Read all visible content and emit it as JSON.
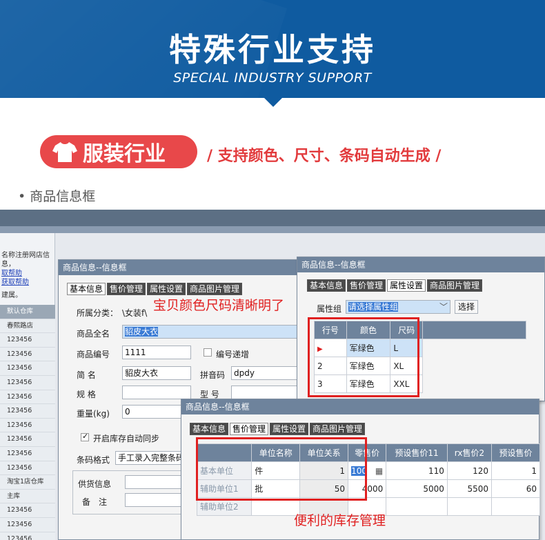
{
  "banner": {
    "title": "特殊行业支持",
    "subtitle": "SPECIAL INDUSTRY SUPPORT",
    "bg_color": "#0f5ba0"
  },
  "feature": {
    "pill_label": "服装行业",
    "icon": "tshirt-icon",
    "tagline": "/ 支持颜色、尺寸、条码自动生成 /",
    "accent": "#e8484a"
  },
  "section_label": "• 商品信息框",
  "left_panel": {
    "note": "名称注册网店信息，",
    "links": [
      "取帮助",
      "获取帮助"
    ],
    "note2": "建属。",
    "warehouses": [
      "默认仓库",
      "春熙路店",
      "123456",
      "123456",
      "123456",
      "123456",
      "123456",
      "123456",
      "123456",
      "123456",
      "123456",
      "123456",
      "淘宝1店仓库",
      "主库",
      "123456",
      "123456",
      "123456",
      "123456"
    ]
  },
  "win1": {
    "title": "商品信息--信息框",
    "tabs": [
      "基本信息",
      "售价管理",
      "属性设置",
      "商品图片管理"
    ],
    "category_label": "所属分类：",
    "category_value": "\\女装f\\",
    "fullname_label": "商品全名",
    "fullname_value": "貂皮大衣",
    "code_label": "商品编号",
    "code_value": "1111",
    "code_incr_label": "编号递增",
    "short_label": "简 名",
    "short_value": "貂皮大衣",
    "pinyin_label": "拼音码",
    "pinyin_value": "dpdy",
    "spec_label": "规 格",
    "model_label": "型 号",
    "weight_label": "重量(kg)",
    "weight_value": "0",
    "sync_label": "开启库存自动同步",
    "barcode_label": "条码格式",
    "barcode_value": "手工录入完整条码",
    "supplier_label": "供货信息",
    "remark_label": "备　注"
  },
  "win2": {
    "title": "商品信息--信息框",
    "tabs": [
      "基本信息",
      "售价管理",
      "属性设置",
      "商品图片管理"
    ],
    "attr_group_label": "属性组",
    "attr_group_value": "请选择属性组",
    "select_button": "选择",
    "grid_headers": [
      "行号",
      "颜色",
      "尺码"
    ],
    "grid_rows": [
      [
        "",
        "军绿色",
        "L"
      ],
      [
        "2",
        "军绿色",
        "XL"
      ],
      [
        "3",
        "军绿色",
        "XXL"
      ]
    ]
  },
  "win3": {
    "title": "商品信息--信息框",
    "tabs": [
      "基本信息",
      "售价管理",
      "属性设置",
      "商品图片管理"
    ],
    "grid_headers": [
      "",
      "单位名称",
      "单位关系",
      "零售价",
      "预设售价11",
      "rx售价2",
      "预设售价"
    ],
    "grid_rows": [
      [
        "基本单位",
        "件",
        "1",
        "100",
        "110",
        "120",
        "1"
      ],
      [
        "辅助单位1",
        "批",
        "50",
        "4000",
        "5000",
        "5500",
        "60"
      ],
      [
        "辅助单位2",
        "",
        "",
        "",
        "",
        "",
        ""
      ]
    ]
  },
  "annotations": {
    "color_size": "宝贝颜色尺码清晰明了",
    "stock": "便利的库存管理"
  }
}
